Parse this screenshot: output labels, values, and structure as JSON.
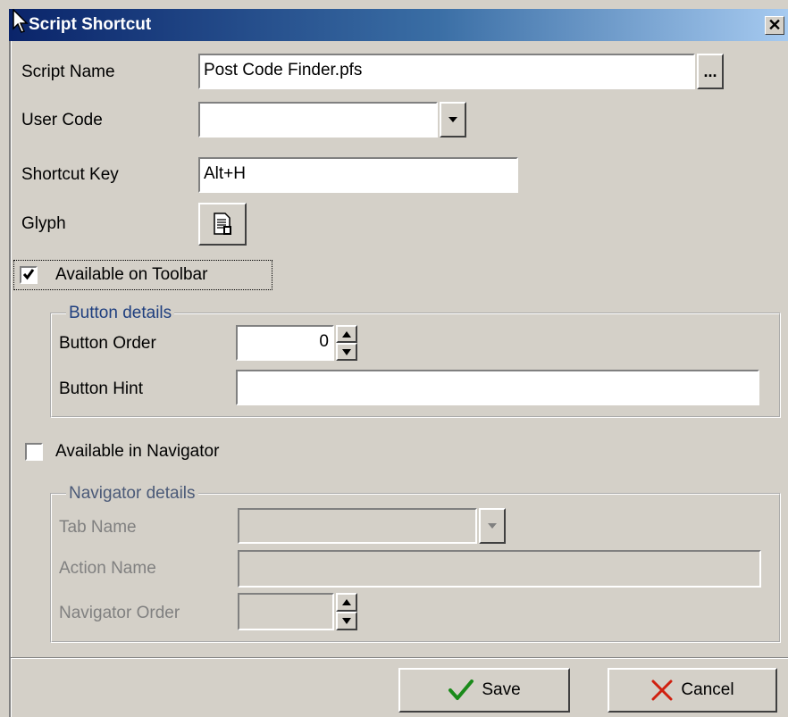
{
  "window": {
    "title": "Script Shortcut",
    "close_glyph": "✕"
  },
  "fields": {
    "script_name": {
      "label": "Script Name",
      "value": "Post Code Finder.pfs",
      "browse": "..."
    },
    "user_code": {
      "label": "User Code",
      "value": ""
    },
    "shortcut_key": {
      "label": "Shortcut Key",
      "value": "Alt+H"
    },
    "glyph": {
      "label": "Glyph"
    }
  },
  "toolbar": {
    "checkbox_label": "Available on Toolbar",
    "checked": true,
    "group_title": "Button details",
    "button_order_label": "Button Order",
    "button_order_value": "0",
    "button_hint_label": "Button Hint",
    "button_hint_value": ""
  },
  "navigator": {
    "checkbox_label": "Available in Navigator",
    "checked": false,
    "group_title": "Navigator details",
    "tab_name_label": "Tab Name",
    "action_name_label": "Action Name",
    "navigator_order_label": "Navigator Order"
  },
  "actions": {
    "save": "Save",
    "cancel": "Cancel"
  },
  "colors": {
    "save_check": "#1a8a1a",
    "cancel_x": "#d02010"
  }
}
